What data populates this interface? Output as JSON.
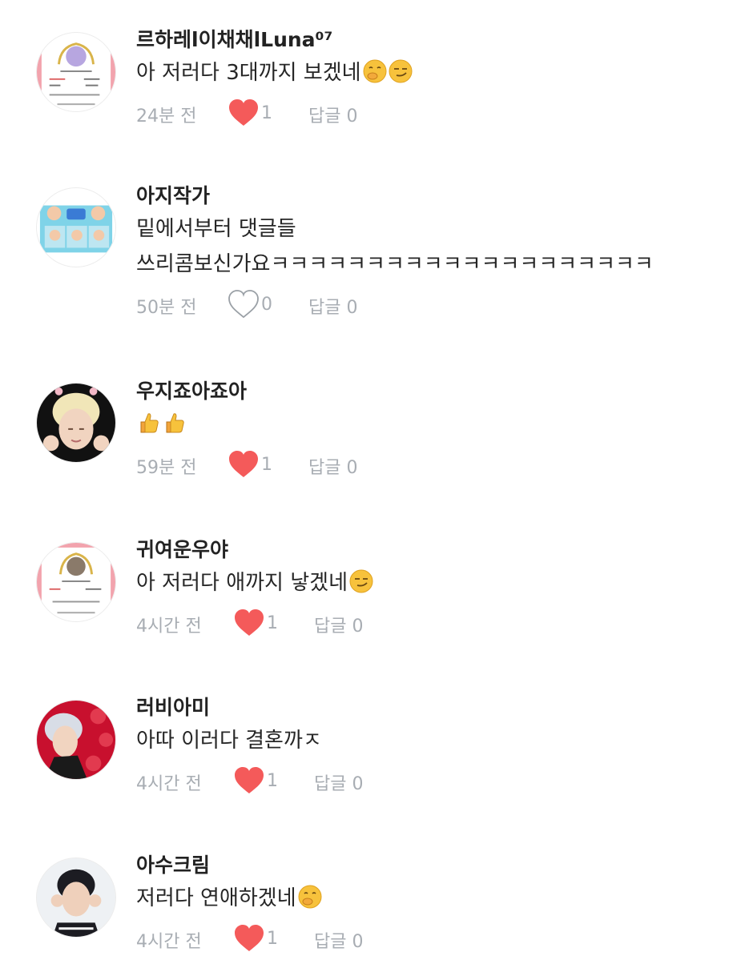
{
  "colors": {
    "heart_filled": "#f45a5a",
    "heart_outline": "#9aa0a6",
    "meta_text": "#a8adb3",
    "username": "#222222",
    "comment_text": "#262626"
  },
  "comments": [
    {
      "username": "르하레l이채채lLuna⁰⁷",
      "lines": [
        "아 저러다 3대까지 보겠네"
      ],
      "line_emojis": [
        [
          "shushing-face-emoji",
          "smirking-face-emoji"
        ]
      ],
      "time": "24분 전",
      "liked": true,
      "likes": "1",
      "reply_label": "답글 0"
    },
    {
      "username": "아지작가",
      "lines": [
        "밑에서부터 댓글들",
        "쓰리콤보신가요ㅋㅋㅋㅋㅋㅋㅋㅋㅋㅋㅋㅋㅋㅋㅋㅋㅋㅋㅋㅋ"
      ],
      "line_emojis": [
        [],
        []
      ],
      "time": "50분 전",
      "liked": false,
      "likes": "0",
      "reply_label": "답글 0"
    },
    {
      "username": "우지죠아죠아",
      "lines": [
        ""
      ],
      "line_emojis": [
        [
          "thumbs-up-emoji",
          "thumbs-up-emoji"
        ]
      ],
      "time": "59분 전",
      "liked": true,
      "likes": "1",
      "reply_label": "답글 0"
    },
    {
      "username": "귀여운우야",
      "lines": [
        "아 저러다 애까지 낳겠네"
      ],
      "line_emojis": [
        [
          "smirking-face-emoji"
        ]
      ],
      "time": "4시간 전",
      "liked": true,
      "likes": "1",
      "reply_label": "답글 0"
    },
    {
      "username": "러비아미",
      "lines": [
        "아따 이러다 결혼까ㅈ"
      ],
      "line_emojis": [
        []
      ],
      "time": "4시간 전",
      "liked": true,
      "likes": "1",
      "reply_label": "답글 0"
    },
    {
      "username": "아수크림",
      "lines": [
        "저러다 연애하겠네"
      ],
      "line_emojis": [
        [
          "shushing-face-emoji"
        ]
      ],
      "time": "4시간 전",
      "liked": true,
      "likes": "1",
      "reply_label": "답글 0"
    }
  ]
}
